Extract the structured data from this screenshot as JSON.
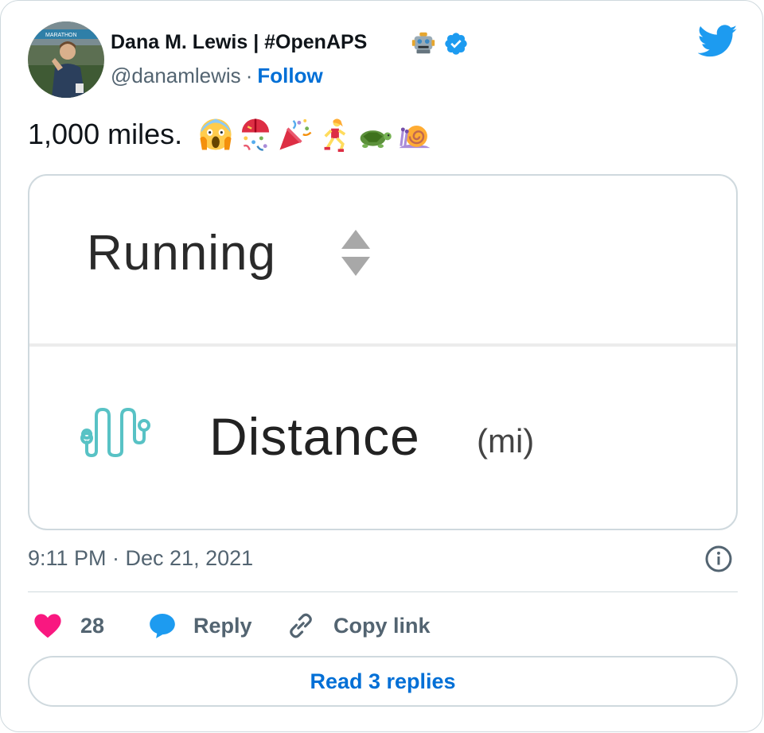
{
  "author": {
    "name": "Dana M. Lewis | #OpenAPS",
    "handle": "@danamlewis",
    "separator": "·",
    "follow_label": "Follow",
    "avatar_banner_text": "MARATHON"
  },
  "tweet": {
    "text": "1,000 miles.",
    "emojis": [
      "face-screaming-in-fear",
      "confetti-ball",
      "party-popper",
      "woman-running",
      "turtle",
      "snail"
    ]
  },
  "media": {
    "running_label": "Running",
    "distance_label": "Distance",
    "distance_unit": "(mi)"
  },
  "meta": {
    "timestamp": "9:11 PM · Dec 21, 2021"
  },
  "actions": {
    "like_count": "28",
    "reply_label": "Reply",
    "copy_link_label": "Copy link",
    "read_replies_label": "Read 3 replies"
  },
  "colors": {
    "accent": "#1d9bf0",
    "link": "#006fd6",
    "like": "#f91880",
    "muted": "#536471",
    "border": "#cfd9de",
    "wave": "#58c2c5"
  }
}
